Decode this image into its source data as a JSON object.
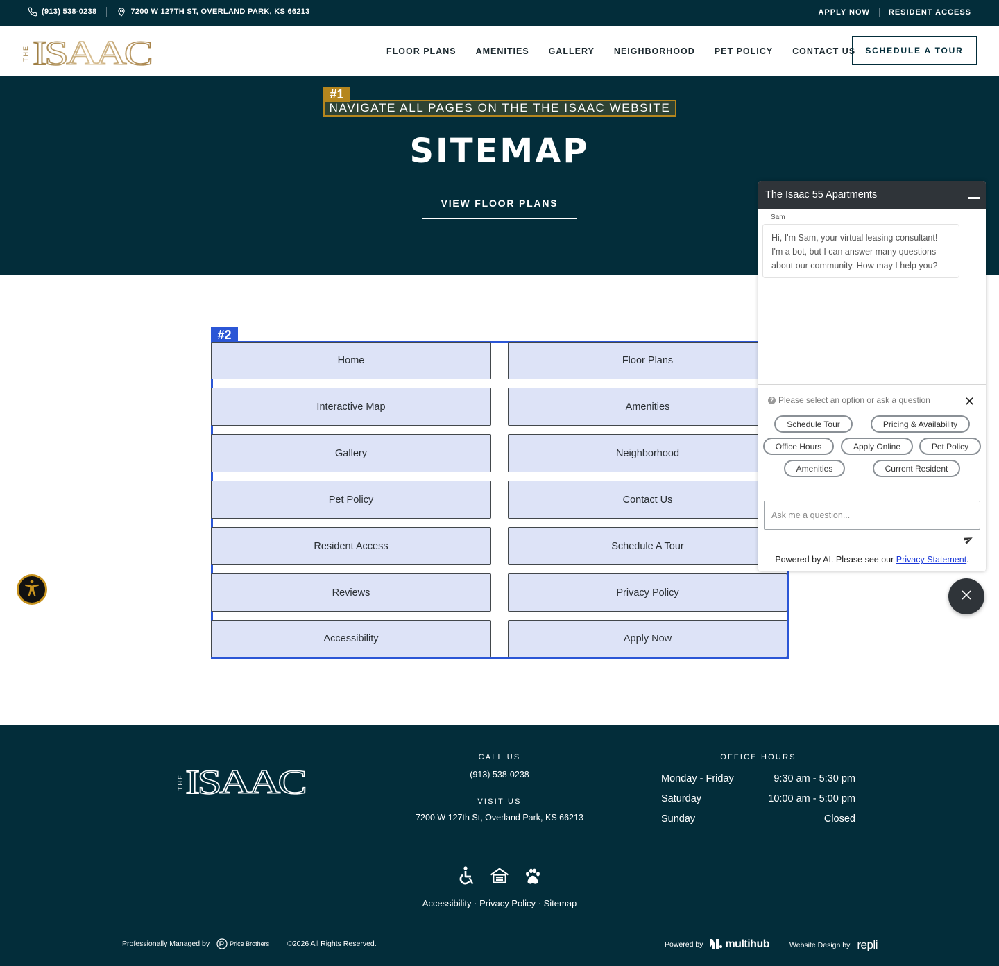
{
  "topbar": {
    "phone": "(913) 538-0238",
    "address": "7200 W 127TH ST, OVERLAND PARK, KS 66213",
    "apply_now": "APPLY NOW",
    "resident_access": "RESIDENT ACCESS"
  },
  "header": {
    "logo_prefix": "THE",
    "logo_text": "ISAAC",
    "nav": [
      "FLOOR PLANS",
      "AMENITIES",
      "GALLERY",
      "NEIGHBORHOOD",
      "PET POLICY",
      "CONTACT US"
    ],
    "cta": "SCHEDULE A TOUR"
  },
  "hero": {
    "tag": "#1",
    "eyebrow": "NAVIGATE ALL PAGES ON THE THE ISAAC WEBSITE",
    "title": "SITEMAP",
    "button": "VIEW FLOOR PLANS"
  },
  "sitemap": {
    "tag": "#2",
    "left": [
      "Home",
      "Interactive Map",
      "Gallery",
      "Pet Policy",
      "Resident Access",
      "Reviews",
      "Accessibility"
    ],
    "right": [
      "Floor Plans",
      "Amenities",
      "Neighborhood",
      "Contact Us",
      "Schedule A Tour",
      "Privacy Policy",
      "Apply Now"
    ]
  },
  "chat": {
    "title": "The Isaac 55 Apartments",
    "sender": "Sam",
    "message": "Hi, I'm Sam, your virtual leasing consultant! I'm a bot, but I can answer many questions about our community. How may I help you?",
    "prompt": "Please select an option or ask a question",
    "chips": [
      "Schedule Tour",
      "Pricing & Availability",
      "Office Hours",
      "Apply Online",
      "Pet Policy",
      "Amenities",
      "Current Resident"
    ],
    "input_placeholder": "Ask me a question...",
    "footer_text": "Powered by AI. Please see our ",
    "footer_link": "Privacy Statement",
    "footer_end": "."
  },
  "footer": {
    "call_label": "CALL US",
    "phone": "(913) 538-0238",
    "visit_label": "VISIT US",
    "address": "7200 W 127th St, Overland Park, KS 66213",
    "hours_label": "OFFICE HOURS",
    "hours": [
      {
        "day": "Monday - Friday",
        "time": "9:30 am - 5:30 pm"
      },
      {
        "day": "Saturday",
        "time": "10:00 am - 5:00 pm"
      },
      {
        "day": "Sunday",
        "time": "Closed"
      }
    ],
    "links": [
      "Accessibility",
      "Privacy Policy",
      "Sitemap"
    ],
    "link_sep": "·",
    "managed_by": "Professionally Managed by",
    "manager_name": "Price Brothers",
    "copyright": "©2026 All Rights Reserved.",
    "powered_by": "Powered by",
    "powered_brand": "multihub",
    "design_by": "Website Design by",
    "design_brand": "repli"
  },
  "colors": {
    "navy": "#032d3a",
    "gold": "#b5861e",
    "highlight_blue": "#2b56d6",
    "tile_fill": "#dde3f7",
    "chat_dark": "#2f3439"
  }
}
